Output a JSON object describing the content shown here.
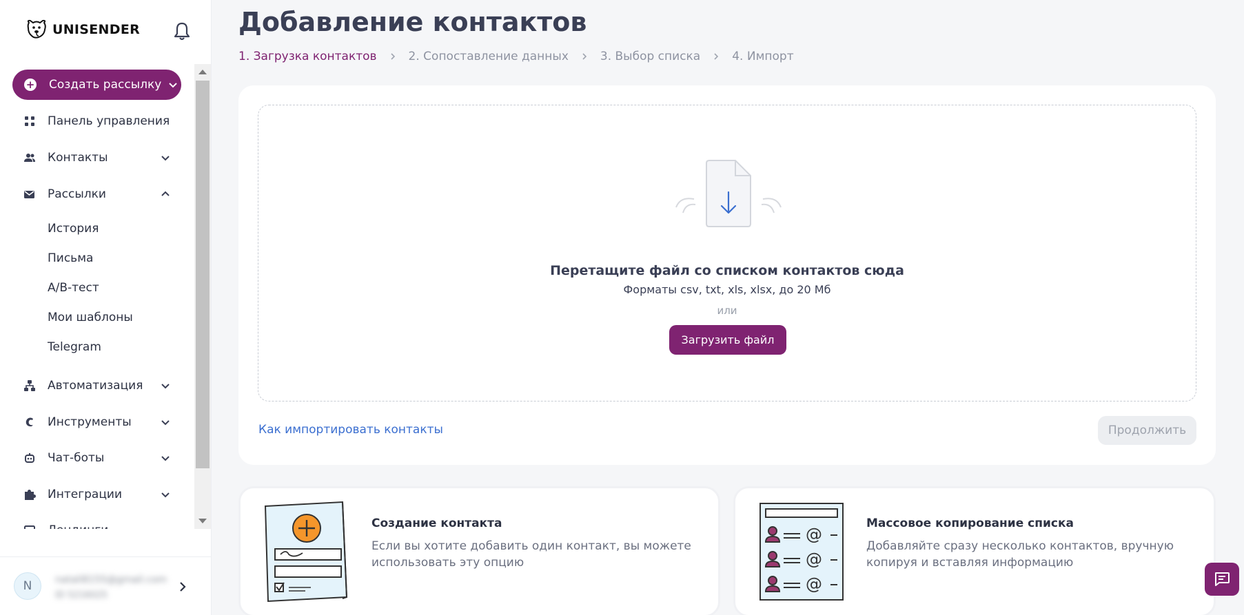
{
  "brand": {
    "name": "UNISENDER",
    "accent": "#7f2371",
    "link_color": "#3b6fd0"
  },
  "sidebar": {
    "create_button": "Создать рассылку",
    "items": [
      {
        "label": "Панель управления",
        "icon": "dashboard-icon"
      },
      {
        "label": "Контакты",
        "icon": "contacts-icon",
        "expanded": false
      },
      {
        "label": "Рассылки",
        "icon": "mail-icon",
        "expanded": true
      },
      {
        "label": "Автоматизация",
        "icon": "automation-icon",
        "expanded": false
      },
      {
        "label": "Инструменты",
        "icon": "tools-icon",
        "expanded": false
      },
      {
        "label": "Чат-боты",
        "icon": "bot-icon",
        "expanded": false
      },
      {
        "label": "Интеграции",
        "icon": "puzzle-icon",
        "expanded": false
      },
      {
        "label": "Лендинги",
        "icon": "landing-icon"
      }
    ],
    "subitems": [
      "История",
      "Письма",
      "A/B-тест",
      "Мои шаблоны",
      "Telegram"
    ],
    "user": {
      "initial": "N",
      "email": "natali8155@gmail.com",
      "id": "ID 5216025"
    }
  },
  "page": {
    "title": "Добавление контактов",
    "steps": [
      "1. Загрузка контактов",
      "2. Сопоставление данных",
      "3. Выбор списка",
      "4. Импорт"
    ],
    "active_step": 0
  },
  "dropzone": {
    "title": "Перетащите файл со списком контактов сюда",
    "formats": "Форматы csv, txt, xls, xlsx, до 20 Мб",
    "or": "или",
    "upload_button": "Загрузить файл"
  },
  "help_link": "Как импортировать контакты",
  "continue_button": "Продолжить",
  "options": [
    {
      "title": "Создание контакта",
      "description": "Если вы хотите добавить один контакт, вы можете использовать эту опцию"
    },
    {
      "title": "Массовое копирование списка",
      "description": "Добавляйте сразу несколько контактов, вручную копируя и вставляя информацию"
    }
  ]
}
